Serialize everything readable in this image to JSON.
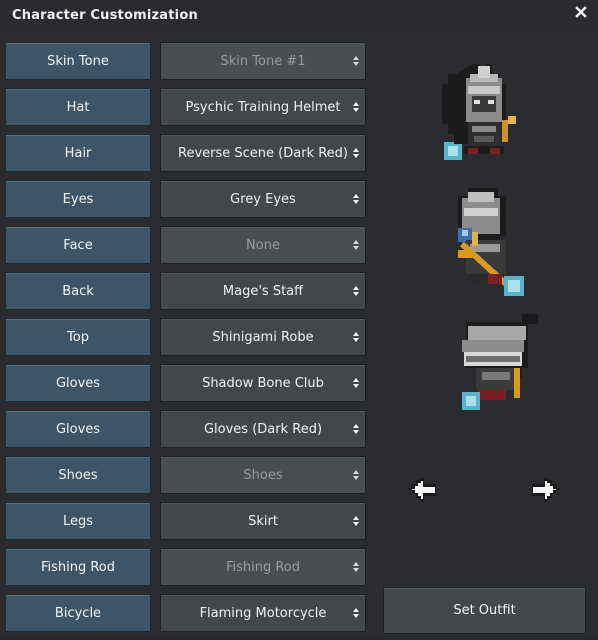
{
  "window": {
    "title": "Character Customization"
  },
  "rows": [
    {
      "label": "Skin Tone",
      "value": "Skin Tone #1",
      "disabled": true
    },
    {
      "label": "Hat",
      "value": "Psychic Training Helmet",
      "disabled": false
    },
    {
      "label": "Hair",
      "value": "Reverse Scene (Dark Red)",
      "disabled": false
    },
    {
      "label": "Eyes",
      "value": "Grey Eyes",
      "disabled": false
    },
    {
      "label": "Face",
      "value": "None",
      "disabled": true
    },
    {
      "label": "Back",
      "value": "Mage's Staff",
      "disabled": false
    },
    {
      "label": "Top",
      "value": "Shinigami Robe",
      "disabled": false
    },
    {
      "label": "Gloves",
      "value": "Shadow Bone Club",
      "disabled": false
    },
    {
      "label": "Gloves",
      "value": "Gloves (Dark Red)",
      "disabled": false
    },
    {
      "label": "Shoes",
      "value": "Shoes",
      "disabled": true
    },
    {
      "label": "Legs",
      "value": "Skirt",
      "disabled": false
    },
    {
      "label": "Fishing Rod",
      "value": "Fishing Rod",
      "disabled": true
    },
    {
      "label": "Bicycle",
      "value": "Flaming Motorcycle",
      "disabled": false
    }
  ],
  "actions": {
    "set_outfit": "Set Outfit"
  },
  "icons": {
    "close": "close-icon",
    "prev": "arrow-left-icon",
    "next": "arrow-right-icon",
    "select_arrows": "updown-arrows-icon"
  },
  "colors": {
    "label_button": "#3d5566",
    "select_bg": "#43464b",
    "window_bg": "#2a2c30"
  }
}
